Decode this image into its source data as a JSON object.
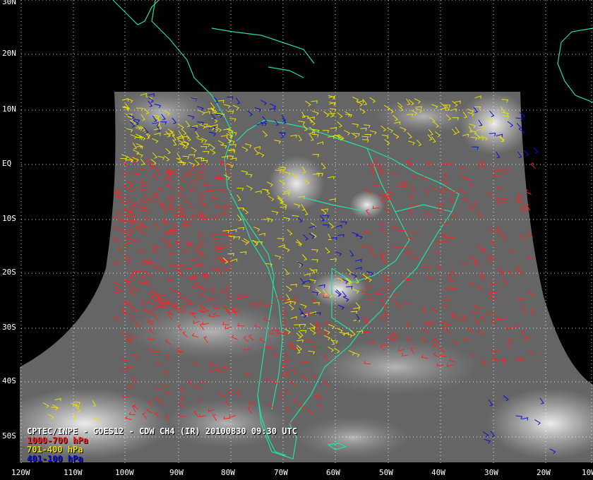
{
  "caption": "CPTEC/INPE - GOES12 - CDW CH4 (IR) 20100830 09:30 UTC",
  "legend": [
    {
      "label": "1000-700 hPa",
      "color": "#ff2020"
    },
    {
      "label": "701-400 hPa",
      "color": "#e8e000"
    },
    {
      "label": "401-100 hPa",
      "color": "#1010d8"
    }
  ],
  "lat_labels": [
    "30N",
    "20N",
    "10N",
    "EQ",
    "10S",
    "20S",
    "30S",
    "40S",
    "50S"
  ],
  "lon_labels": [
    "120W",
    "110W",
    "100W",
    "90W",
    "80W",
    "70W",
    "60W",
    "50W",
    "40W",
    "30W",
    "20W",
    "10W"
  ],
  "colors": {
    "background": "#000000",
    "coastline": "#20e0a0",
    "grid": "#ffffff",
    "imagery": "#6a6a6a"
  }
}
